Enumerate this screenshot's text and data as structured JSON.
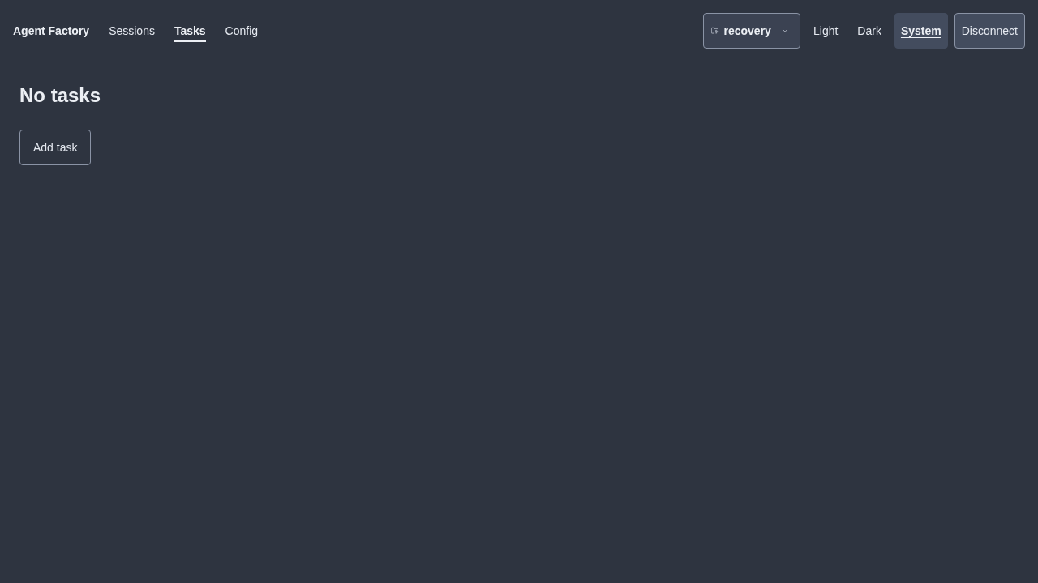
{
  "nav": {
    "brand": "Agent Factory",
    "links": [
      {
        "label": "Sessions",
        "selected": false
      },
      {
        "label": "Tasks",
        "selected": true
      },
      {
        "label": "Config",
        "selected": false
      }
    ]
  },
  "workspace": {
    "name": "recovery"
  },
  "theme": [
    {
      "label": "Light",
      "selected": false
    },
    {
      "label": "Dark",
      "selected": false
    },
    {
      "label": "System",
      "selected": true
    }
  ],
  "disconnect": "Disconnect",
  "main": {
    "heading": "No tasks",
    "add_button": "Add task"
  }
}
